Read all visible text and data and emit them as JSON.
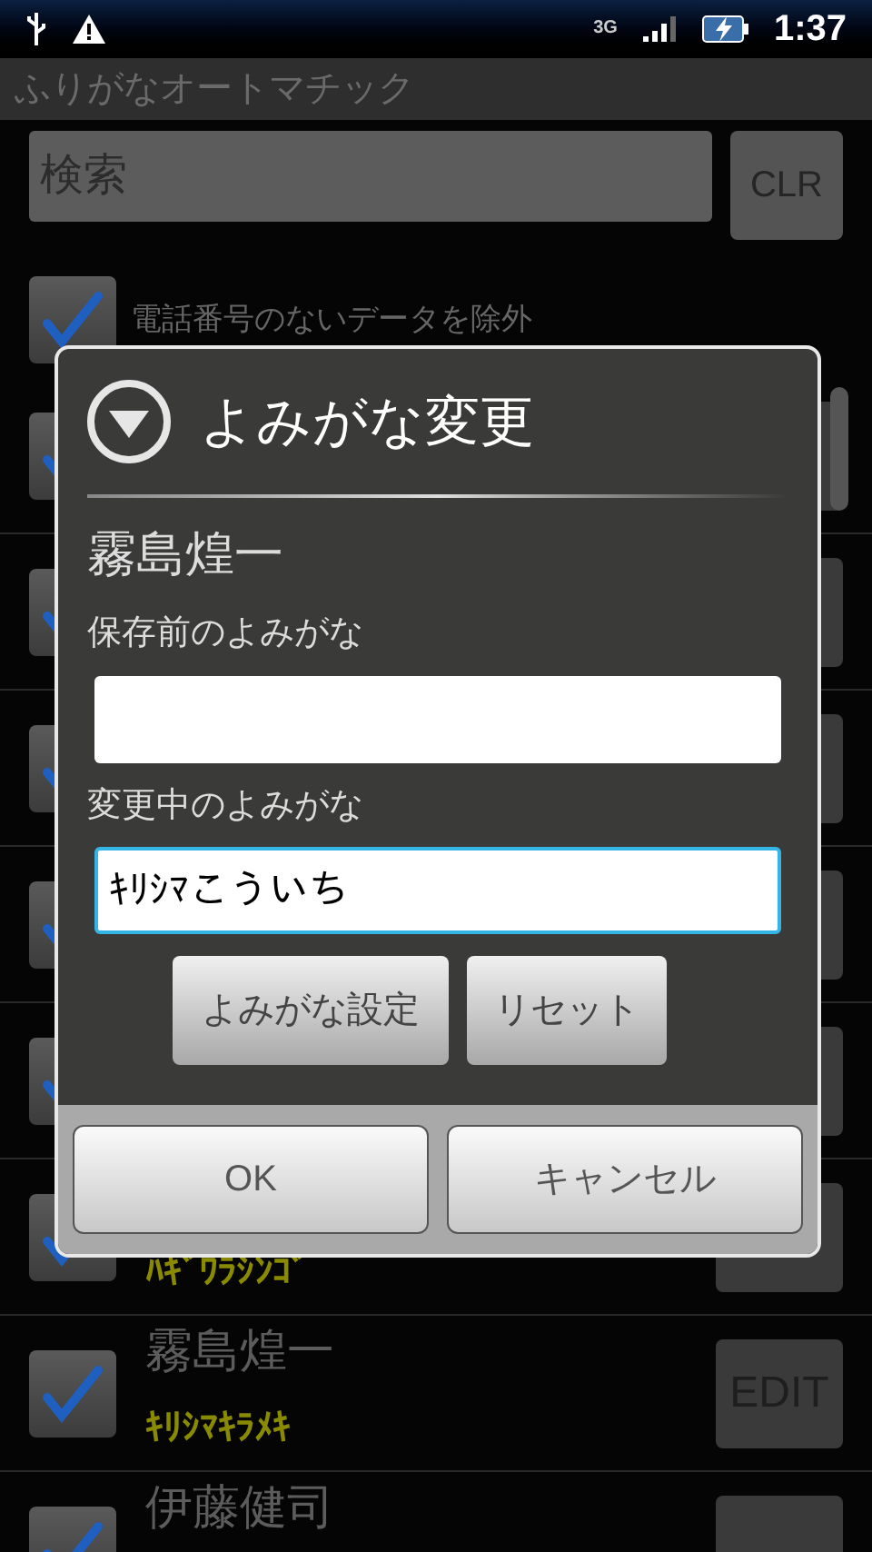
{
  "status_bar": {
    "network": "3G",
    "time": "1:37"
  },
  "app_title": "ふりがなオートマチック",
  "search": {
    "placeholder": "検索",
    "clear_button": "CLR"
  },
  "filter": {
    "label": "電話番号のないデータを除外",
    "checked": true
  },
  "contacts": [
    {
      "checked": true
    },
    {
      "checked": true
    },
    {
      "checked": true
    },
    {
      "checked": true
    },
    {
      "checked": true
    },
    {
      "checked": true,
      "reading": "ﾊｷﾞﾜﾗｼﾝｺﾞ"
    },
    {
      "checked": true,
      "name": "霧島煌一",
      "reading": "ｷﾘｼﾏｷﾗﾒｷ",
      "button": "EDIT"
    },
    {
      "checked": true,
      "name": "伊藤健司"
    }
  ],
  "dialog": {
    "title": "よみがな変更",
    "name": "霧島煌一",
    "before_label": "保存前のよみがな",
    "after_label": "変更中のよみがな",
    "after_value": "ｷﾘｼﾏこういち",
    "set_button": "よみがな設定",
    "reset_button": "リセット",
    "ok_button": "OK",
    "cancel_button": "キャンセル"
  }
}
